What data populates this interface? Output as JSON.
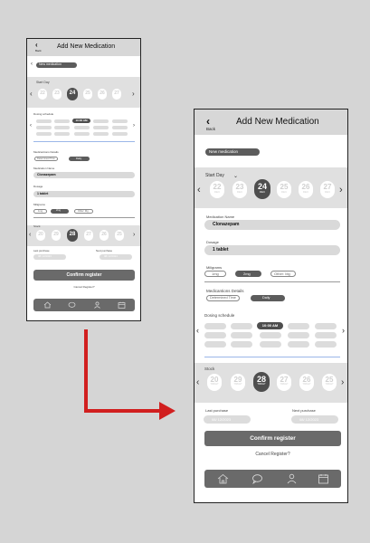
{
  "page": {
    "header": {
      "back_label": "Back",
      "title": "Add New Medication"
    },
    "name_pill": "New medication",
    "start_day": {
      "label": "Start Day",
      "days": [
        {
          "num": "22",
          "month": "DEC"
        },
        {
          "num": "23",
          "month": "DEC"
        },
        {
          "num": "24",
          "month": "DEC",
          "selected": true
        },
        {
          "num": "25",
          "month": "DEC"
        },
        {
          "num": "26",
          "month": "DEC"
        },
        {
          "num": "27",
          "month": "DEC"
        }
      ]
    },
    "medication_name": {
      "label": "Medication Name",
      "value": "Clonazepam"
    },
    "dosage": {
      "label": "Dosage",
      "value": "1 tablet"
    },
    "miligrams": {
      "label": "Miligrams",
      "options": [
        "1mg",
        "2mg",
        "Other: Mg"
      ]
    },
    "details": {
      "label": "Medicantions Details",
      "options": [
        "Determined Time",
        "Daily"
      ]
    },
    "dosing": {
      "label": "Dosing schedule",
      "selected_time": "10:00 AM"
    },
    "stock": {
      "label": "Stock",
      "days": [
        {
          "num": "20",
          "unit": "TABLET"
        },
        {
          "num": "29",
          "unit": "TABLET"
        },
        {
          "num": "28",
          "unit": "TABLET",
          "selected": true
        },
        {
          "num": "27",
          "unit": "TABLET"
        },
        {
          "num": "26",
          "unit": "TABLET"
        },
        {
          "num": "25",
          "unit": "TABLET"
        }
      ]
    },
    "purchase": {
      "last_label": "Last purchase",
      "last_value": "08/ 12/2023",
      "next_label": "Next purchase",
      "next_value": "08/ 12/2023"
    },
    "confirm_label": "Confirm register",
    "cancel_label": "Cancel Register?",
    "nav": [
      "home-icon",
      "chat-icon",
      "profile-icon",
      "calendar-icon"
    ]
  },
  "colors": {
    "arrow": "#d11f1f",
    "selected": "#4e4e4e",
    "button": "#6a6a6a"
  }
}
